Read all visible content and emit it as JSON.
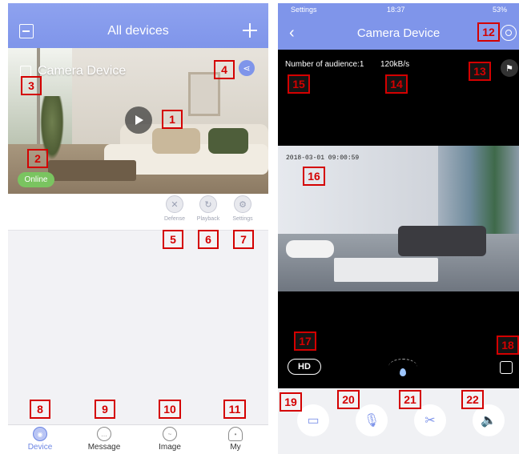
{
  "left_screen": {
    "header": {
      "title": "All devices"
    },
    "device": {
      "name": "Camera Device",
      "status": "Online"
    },
    "actions": [
      {
        "label": "Defense",
        "icon": "shield-icon"
      },
      {
        "label": "Playback",
        "icon": "playback-icon"
      },
      {
        "label": "Settings",
        "icon": "gear-icon"
      }
    ],
    "tabs": [
      {
        "label": "Device",
        "icon": "device-icon",
        "active": true
      },
      {
        "label": "Message",
        "icon": "message-icon",
        "active": false
      },
      {
        "label": "Image",
        "icon": "image-icon",
        "active": false
      },
      {
        "label": "My",
        "icon": "user-icon",
        "active": false
      }
    ]
  },
  "right_screen": {
    "status_bar": {
      "carrier": "Settings",
      "time": "18:37",
      "battery": "53%"
    },
    "header": {
      "title": "Camera Device"
    },
    "audience": "Number of audience:1",
    "bitrate": "120kB/s",
    "video_timestamp": "2018-03-01  09:00:59",
    "hd_label": "HD",
    "controls": [
      {
        "icon": "video-record-icon"
      },
      {
        "icon": "microphone-icon"
      },
      {
        "icon": "scissors-icon"
      },
      {
        "icon": "speaker-icon"
      }
    ]
  },
  "markers": {
    "m1": "1",
    "m2": "2",
    "m3": "3",
    "m4": "4",
    "m5": "5",
    "m6": "6",
    "m7": "7",
    "m8": "8",
    "m9": "9",
    "m10": "10",
    "m11": "11",
    "m12": "12",
    "m13": "13",
    "m14": "14",
    "m15": "15",
    "m16": "16",
    "m17": "17",
    "m18": "18",
    "m19": "19",
    "m20": "20",
    "m21": "21",
    "m22": "22"
  },
  "colors": {
    "accent": "#7f95ea",
    "online": "#7ac460",
    "marker": "#d40000"
  }
}
